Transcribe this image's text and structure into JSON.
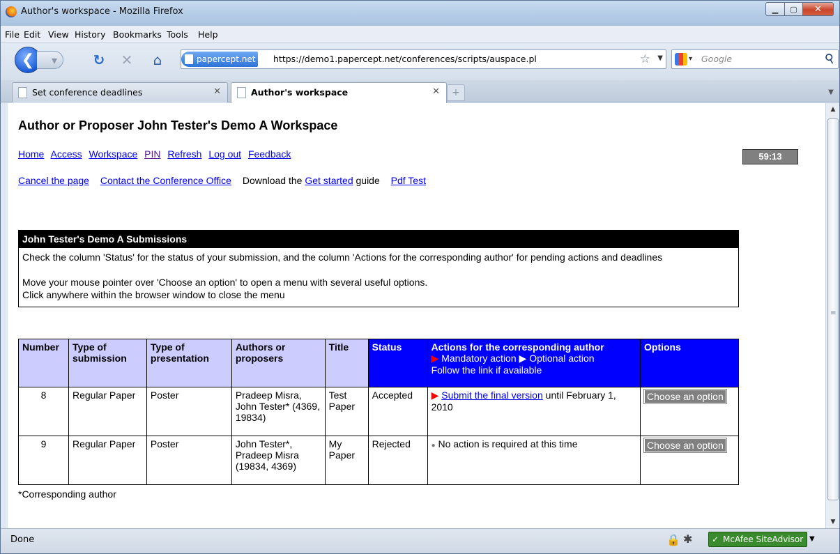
{
  "window": {
    "title": "Author's workspace - Mozilla Firefox"
  },
  "menu": [
    {
      "label": "File"
    },
    {
      "label": "Edit"
    },
    {
      "label": "View"
    },
    {
      "label": "History"
    },
    {
      "label": "Bookmarks"
    },
    {
      "label": "Tools"
    },
    {
      "label": "Help"
    }
  ],
  "nav": {
    "site_badge": "papercept.net",
    "url": "https://demo1.papercept.net/conferences/scripts/auspace.pl",
    "search_placeholder": "Google"
  },
  "tabs": [
    {
      "label": "Set conference deadlines",
      "active": false
    },
    {
      "label": "Author's workspace",
      "active": true
    }
  ],
  "page": {
    "title": "Author or Proposer John Tester's Demo A Workspace",
    "links1": [
      "Home",
      "Access",
      "Workspace",
      "PIN",
      "Refresh",
      "Log out",
      "Feedback"
    ],
    "timer": "59:13",
    "links2": {
      "cancel": "Cancel the page",
      "contact": "Contact the Conference Office",
      "download_prefix": "Download the",
      "get_started": "Get started",
      "guide_suffix": "guide",
      "pdf_test": "Pdf Test"
    },
    "panel": {
      "header": "John Tester's Demo A Submissions",
      "line1": "Check the column 'Status' for the status of your submission, and the column 'Actions for the corresponding author' for pending actions and deadlines",
      "line2": "Move your mouse pointer over 'Choose an option' to open a menu with several useful options.",
      "line3": "Click anywhere within the browser window to close the menu"
    },
    "table": {
      "headers": {
        "number": "Number",
        "type_submission": "Type of submission",
        "type_presentation": "Type of presentation",
        "authors": "Authors or proposers",
        "title": "Title",
        "status": "Status",
        "actions": "Actions for the corresponding author",
        "actions_mandatory": "Mandatory action",
        "actions_optional": "Optional action",
        "actions_follow": "Follow the link if available",
        "options": "Options"
      },
      "rows": [
        {
          "number": "8",
          "type_submission": "Regular Paper",
          "type_presentation": "Poster",
          "authors": "Pradeep Misra, John Tester* (4369, 19834)",
          "title": "Test Paper",
          "status": "Accepted",
          "action_link": "Submit the final version",
          "action_suffix": "until February 1, 2010",
          "option": "Choose an option"
        },
        {
          "number": "9",
          "type_submission": "Regular Paper",
          "type_presentation": "Poster",
          "authors": "John Tester*, Pradeep Misra (19834, 4369)",
          "title": "My Paper",
          "status": "Rejected",
          "action_text": "No action is required at this time",
          "option": "Choose an option"
        }
      ]
    },
    "footnote": "*Corresponding author"
  },
  "statusbar": {
    "text": "Done",
    "mcafee": "McAfee SiteAdvisor"
  }
}
